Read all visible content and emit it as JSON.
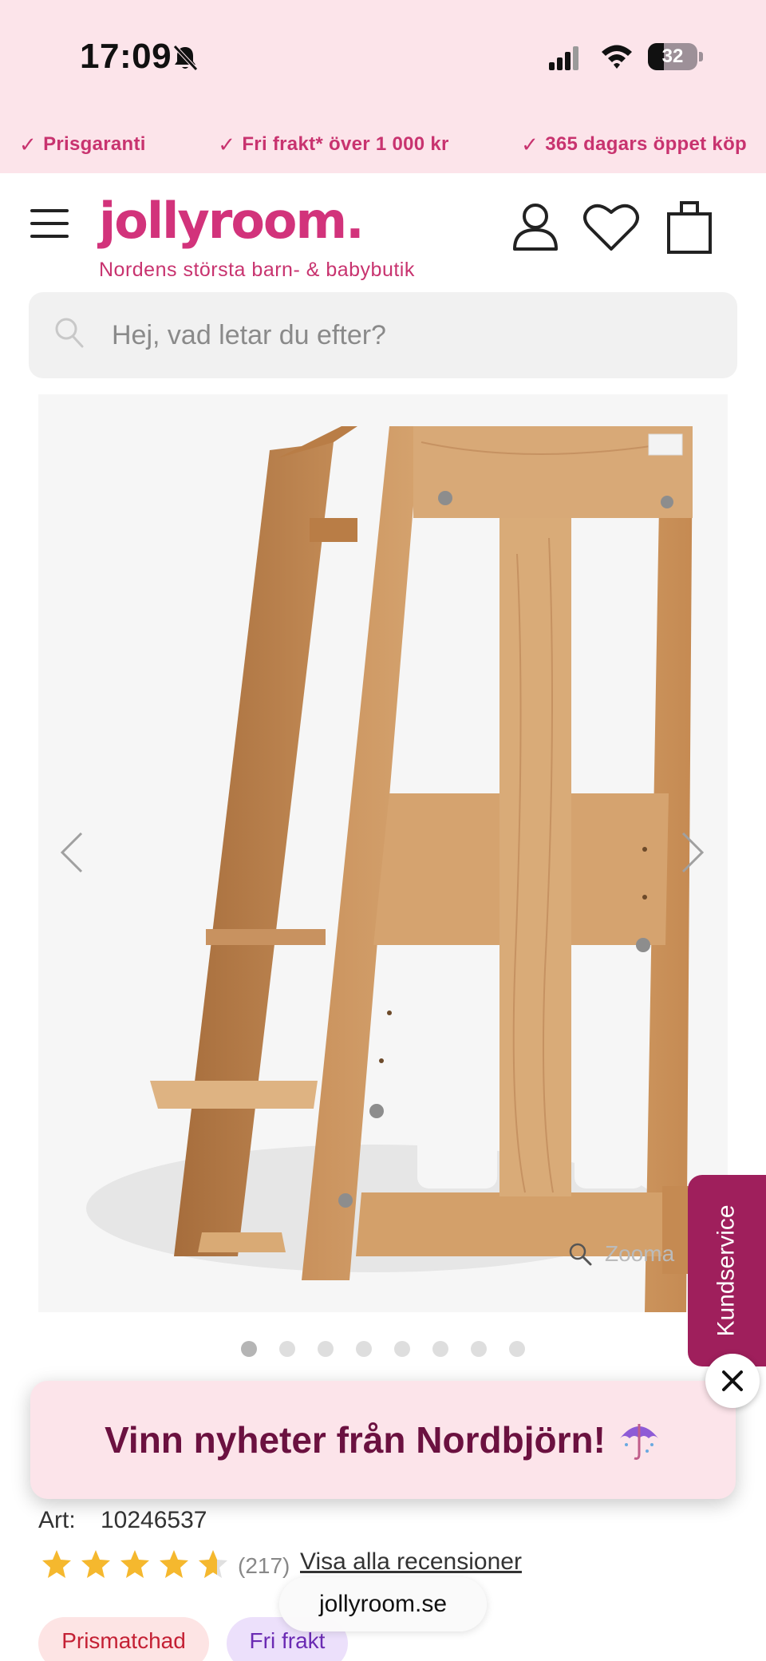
{
  "status_bar": {
    "time": "17:09",
    "battery": "32"
  },
  "usp": [
    {
      "label": "Prisgaranti"
    },
    {
      "label": "Fri frakt* över 1 000 kr"
    },
    {
      "label": "365 dagars öppet köp"
    }
  ],
  "header": {
    "logo": "jollyroom.",
    "tagline": "Nordens största barn- & babybutik"
  },
  "search": {
    "placeholder": "Hej, vad letar du efter?"
  },
  "gallery": {
    "zoom_label": "Zooma",
    "image_count": 8,
    "active_index": 0
  },
  "kundservice": {
    "label": "Kundservice"
  },
  "popup": {
    "text": "Vinn nyheter från Nordbjörn!",
    "icon": "umbrella-icon"
  },
  "product": {
    "art_label": "Art:",
    "art_number": "10246537",
    "rating": 4.5,
    "review_count": "(217)",
    "reviews_link": "Visa alla recensioner"
  },
  "browser": {
    "url": "jollyroom.se"
  },
  "badges": [
    {
      "label": "Prismatchad",
      "color": "#c42034"
    },
    {
      "label": "Fri frakt",
      "color": "#6b2bb3"
    }
  ],
  "colors": {
    "brand": "#d2337b",
    "kundservice": "#9f1f5c",
    "popup_bg": "#fce4ea"
  }
}
